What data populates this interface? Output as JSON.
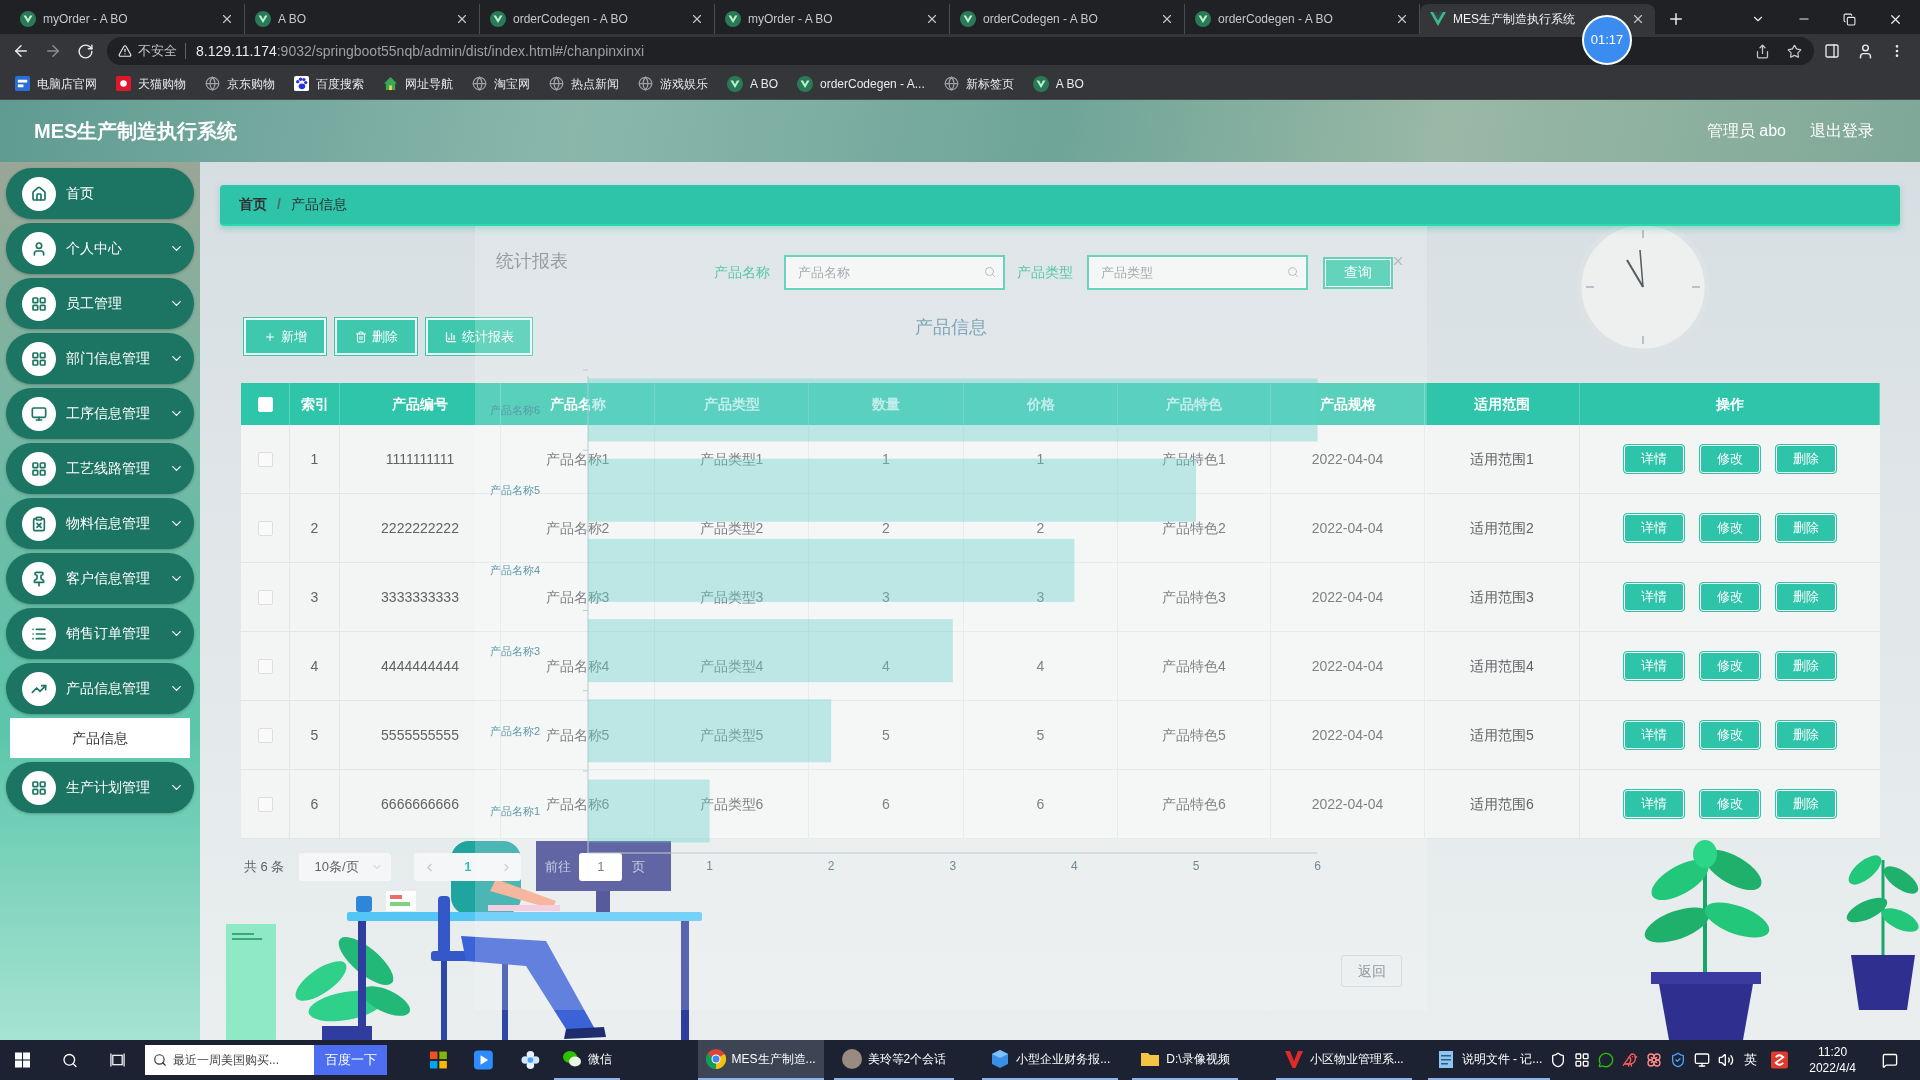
{
  "browser": {
    "tabs": [
      {
        "title": "myOrder - A BO",
        "selected": false
      },
      {
        "title": "A BO",
        "selected": false
      },
      {
        "title": "orderCodegen - A BO",
        "selected": false
      },
      {
        "title": "myOrder - A BO",
        "selected": false
      },
      {
        "title": "orderCodegen - A BO",
        "selected": false
      },
      {
        "title": "orderCodegen - A BO",
        "selected": false
      },
      {
        "title": "MES生产制造执行系统",
        "selected": true
      }
    ],
    "security_label": "不安全",
    "url": {
      "host": "8.129.11.174",
      "path": ":9032/springboot55nqb/admin/dist/index.html#/chanpinxinxi"
    },
    "bookmarks": [
      "电脑店官网",
      "天猫购物",
      "京东购物",
      "百度搜索",
      "网址导航",
      "淘宝网",
      "热点新闻",
      "游戏娱乐",
      "A BO",
      "orderCodegen - A...",
      "新标签页",
      "A BO"
    ],
    "recording_timer": "01:17"
  },
  "header": {
    "title": "MES生产制造执行系统",
    "user": "管理员 abo",
    "logout": "退出登录"
  },
  "sidebar": {
    "items": [
      {
        "label": "首页",
        "kind": "link"
      },
      {
        "label": "个人中心",
        "kind": "submenu"
      },
      {
        "label": "员工管理",
        "kind": "submenu"
      },
      {
        "label": "部门信息管理",
        "kind": "submenu"
      },
      {
        "label": "工序信息管理",
        "kind": "submenu"
      },
      {
        "label": "工艺线路管理",
        "kind": "submenu"
      },
      {
        "label": "物料信息管理",
        "kind": "submenu"
      },
      {
        "label": "客户信息管理",
        "kind": "submenu"
      },
      {
        "label": "销售订单管理",
        "kind": "submenu"
      },
      {
        "label": "产品信息管理",
        "kind": "submenu",
        "children": [
          {
            "label": "产品信息",
            "selected": true
          }
        ]
      },
      {
        "label": "生产计划管理",
        "kind": "submenu"
      }
    ]
  },
  "breadcrumb": {
    "items": [
      "首页",
      "产品信息"
    ],
    "separator": "/"
  },
  "search": {
    "fields": [
      {
        "label": "产品名称",
        "placeholder": "产品名称"
      },
      {
        "label": "产品类型",
        "placeholder": "产品类型"
      }
    ],
    "button": "查询"
  },
  "actions": [
    {
      "kind": "add",
      "label": "新增"
    },
    {
      "kind": "delete",
      "label": "删除"
    },
    {
      "kind": "report",
      "label": "统计报表"
    }
  ],
  "table": {
    "columns": [
      "索引",
      "产品编号",
      "产品名称",
      "产品类型",
      "数量",
      "价格",
      "产品特色",
      "产品规格",
      "适用范围",
      "操作"
    ],
    "all_selected": false,
    "rows": [
      {
        "selected": false,
        "cells": [
          "1",
          "1111111111",
          "产品名称1",
          "产品类型1",
          "1",
          "1",
          "产品特色1",
          "2022-04-04",
          "适用范围1"
        ],
        "actions": [
          "详情",
          "修改",
          "删除"
        ]
      },
      {
        "selected": false,
        "cells": [
          "2",
          "2222222222",
          "产品名称2",
          "产品类型2",
          "2",
          "2",
          "产品特色2",
          "2022-04-04",
          "适用范围2"
        ],
        "actions": [
          "详情",
          "修改",
          "删除"
        ]
      },
      {
        "selected": false,
        "cells": [
          "3",
          "3333333333",
          "产品名称3",
          "产品类型3",
          "3",
          "3",
          "产品特色3",
          "2022-04-04",
          "适用范围3"
        ],
        "actions": [
          "详情",
          "修改",
          "删除"
        ]
      },
      {
        "selected": false,
        "cells": [
          "4",
          "4444444444",
          "产品名称4",
          "产品类型4",
          "4",
          "4",
          "产品特色4",
          "2022-04-04",
          "适用范围4"
        ],
        "actions": [
          "详情",
          "修改",
          "删除"
        ]
      },
      {
        "selected": false,
        "cells": [
          "5",
          "5555555555",
          "产品名称5",
          "产品类型5",
          "5",
          "5",
          "产品特色5",
          "2022-04-04",
          "适用范围5"
        ],
        "actions": [
          "详情",
          "修改",
          "删除"
        ]
      },
      {
        "selected": false,
        "cells": [
          "6",
          "6666666666",
          "产品名称6",
          "产品类型6",
          "6",
          "6",
          "产品特色6",
          "2022-04-04",
          "适用范围6"
        ],
        "actions": [
          "详情",
          "修改",
          "删除"
        ]
      }
    ]
  },
  "pagination": {
    "total": "共 6 条",
    "page_size": "10条/页",
    "pages": [
      {
        "label": "1",
        "selected": true
      }
    ],
    "goto_label": "前往",
    "goto_value": "1",
    "goto_unit": "页"
  },
  "stats_dialog": {
    "title": "统计报表",
    "chart_data": {
      "type": "bar",
      "orientation": "horizontal",
      "title": "产品信息",
      "categories": [
        "产品名称6",
        "产品名称5",
        "产品名称4",
        "产品名称3",
        "产品名称2",
        "产品名称1"
      ],
      "values": [
        6,
        5,
        4,
        3,
        2,
        1
      ],
      "xlim": [
        0,
        6
      ],
      "xticks": [
        1,
        2,
        3,
        4,
        5,
        6
      ]
    },
    "back_button": "返回"
  },
  "taskbar": {
    "search_placeholder": "最近一周美国购买...",
    "search_button": "百度一下",
    "apps": [
      {
        "label": "微信",
        "selected": false
      },
      {
        "label": "MES生产制造...",
        "selected": true
      },
      {
        "label": "美玲等2个会话",
        "selected": false
      },
      {
        "label": "小型企业财务报...",
        "selected": false
      },
      {
        "label": "D:\\录像视频",
        "selected": false
      },
      {
        "label": "小区物业管理系...",
        "selected": false
      },
      {
        "label": "说明文件 - 记...",
        "selected": false
      }
    ],
    "ime": "英",
    "time": "11:20",
    "date": "2022/4/4"
  }
}
